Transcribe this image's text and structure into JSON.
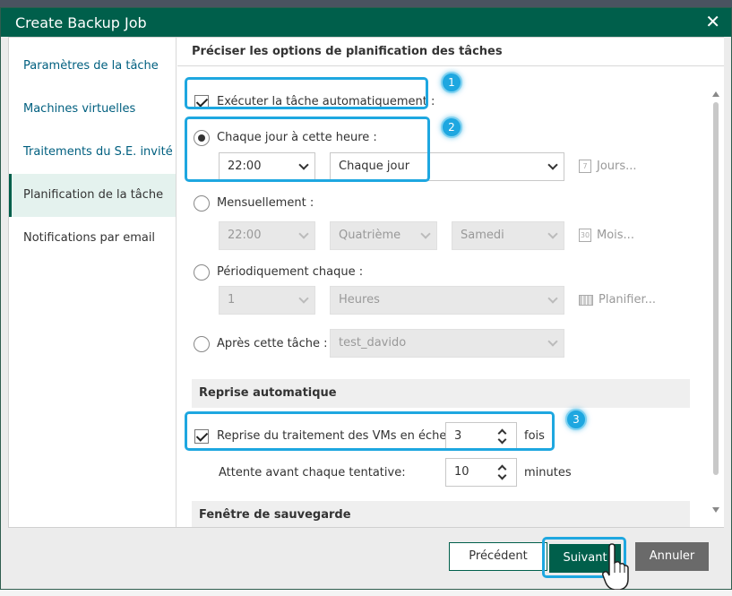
{
  "window": {
    "title": "Create Backup Job"
  },
  "sidebar": {
    "items": [
      {
        "label": "Paramètres de la tâche"
      },
      {
        "label": "Machines virtuelles"
      },
      {
        "label": "Traitements du S.E. invité"
      },
      {
        "label": "Planification de la tâche"
      },
      {
        "label": "Notifications par email"
      }
    ]
  },
  "content": {
    "header": "Préciser les options de planification des tâches",
    "auto_run_label": "Exécuter la tâche automatiquement :",
    "daily": {
      "label": "Chaque jour à cette heure :",
      "time": "22:00",
      "frequency": "Chaque jour",
      "days_link": "Jours...",
      "cal_icon_text": "7"
    },
    "monthly": {
      "label": "Mensuellement :",
      "time": "22:00",
      "week": "Quatrième",
      "day": "Samedi",
      "months_link": "Mois...",
      "cal_icon_text": "30"
    },
    "periodic": {
      "label": "Périodiquement chaque :",
      "count": "1",
      "unit": "Heures",
      "schedule_link": "Planifier..."
    },
    "after_job": {
      "label": "Après cette tâche :",
      "job": "test_davido"
    },
    "retry_section": {
      "title": "Reprise automatique",
      "retry_label": "Reprise du traitement des VMs en échec:",
      "retry_count": "3",
      "retry_unit": "fois",
      "wait_label": "Attente avant chaque tentative:",
      "wait_value": "10",
      "wait_unit": "minutes"
    },
    "window_section": {
      "title": "Fenêtre de sauvegarde"
    }
  },
  "badges": [
    "1",
    "2",
    "3"
  ],
  "footer": {
    "prev_label": "Précédent",
    "next_label": "Suivant",
    "cancel_label": "Annuler"
  },
  "colors": {
    "brand_green": "#005f4b",
    "highlight_blue": "#1ea7e0"
  }
}
